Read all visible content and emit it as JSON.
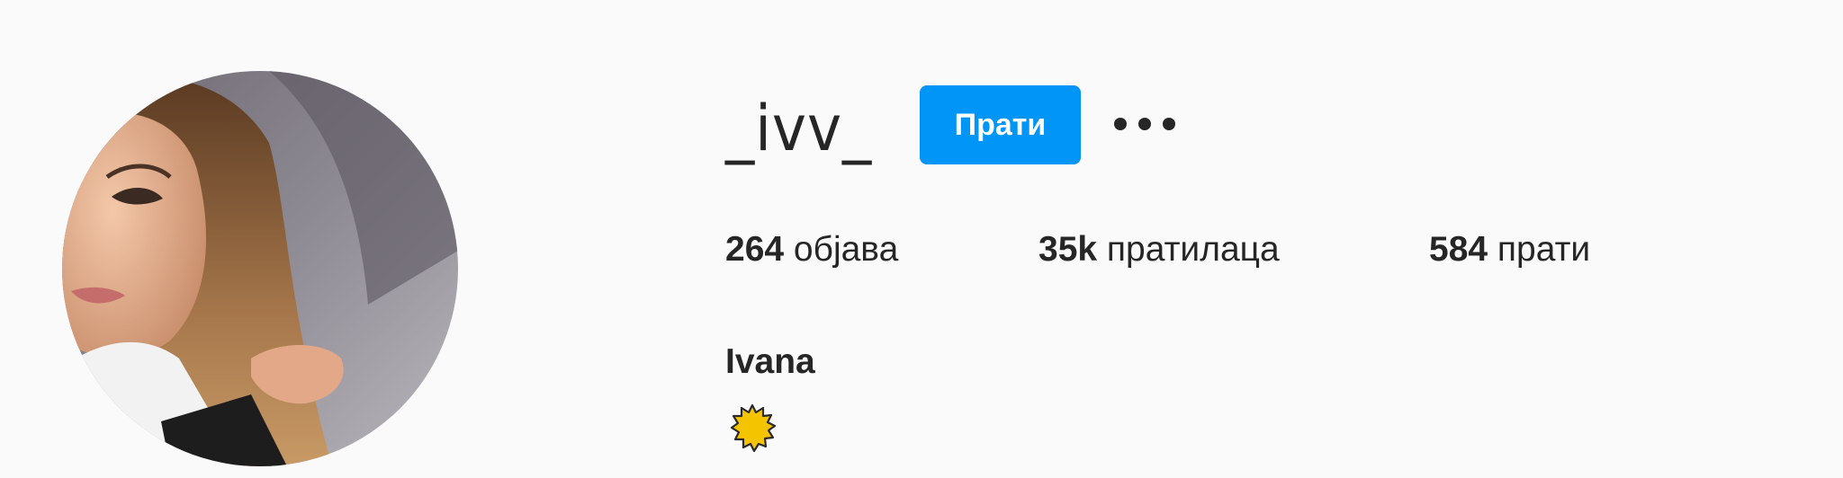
{
  "profile": {
    "username": "_ivv_",
    "follow_label": "Прати",
    "more_label": "•••",
    "full_name": "Ivana",
    "bio_emoji": "sun-icon"
  },
  "stats": {
    "posts_count": "264",
    "posts_label": "објава",
    "followers_count": "35k",
    "followers_label": "пратилаца",
    "following_count": "584",
    "following_label": "прати"
  },
  "colors": {
    "background": "#fafafa",
    "text": "#262626",
    "follow_button": "#0095f6",
    "follow_text": "#ffffff",
    "emoji_fill": "#f5c400"
  }
}
